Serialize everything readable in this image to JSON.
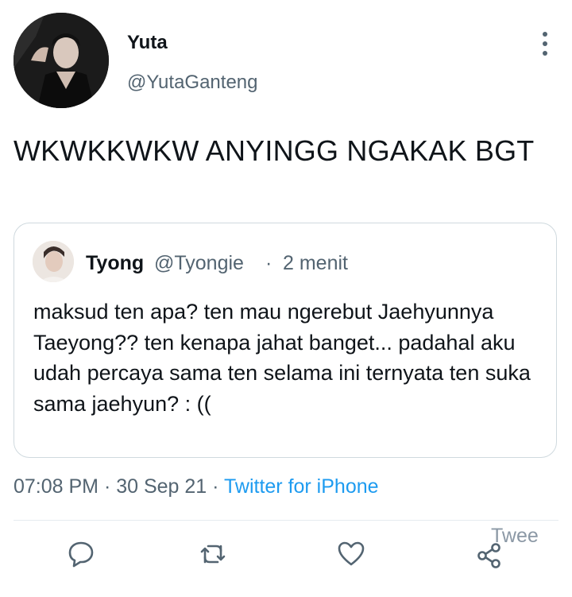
{
  "tweet": {
    "display_name": "Yuta",
    "handle": "@YutaGanteng",
    "text": "WKWKKWKW ANYINGG NGAKAK BGT",
    "timestamp": "07:08 PM · 30 Sep 21",
    "meta_separator": "·",
    "source": "Twitter for iPhone"
  },
  "quoted": {
    "display_name": "Tyong",
    "handle": "@Tyongie",
    "separator": "·",
    "relative_time": "2 menit",
    "text": "maksud ten apa? ten mau ngerebut Jaehyunnya Taeyong?? ten kenapa jahat banget... padahal aku udah percaya sama ten selama ini ternyata ten suka sama jaehyun? : (("
  },
  "actions": {
    "icons": [
      "reply-icon",
      "retweet-icon",
      "like-icon",
      "share-icon"
    ],
    "share_label": "Twee"
  },
  "colors": {
    "text_primary": "#0f1419",
    "text_secondary": "#536471",
    "link": "#1d9bf0",
    "border": "#cfd9de"
  }
}
